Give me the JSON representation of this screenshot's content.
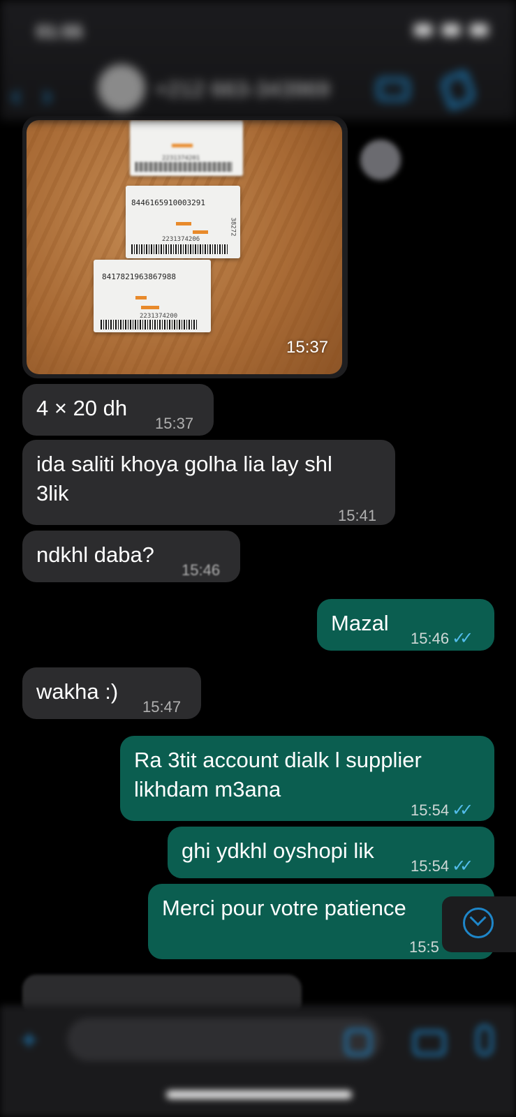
{
  "status_bar": {
    "time": "01:55"
  },
  "header": {
    "contact_name": "+212 663-343969"
  },
  "photo_message": {
    "time": "15:37",
    "cards": [
      {
        "code": "",
        "serial": "2231374201"
      },
      {
        "code": "8446165910003291",
        "serial": "2231374206",
        "side": "38272"
      },
      {
        "code": "8417821963867988",
        "serial": "2231374200"
      }
    ]
  },
  "messages": [
    {
      "dir": "in",
      "text": "4 × 20 dh",
      "time": "15:37"
    },
    {
      "dir": "in",
      "text": "ida saliti khoya golha lia lay shl",
      "text2": "3lik",
      "time": "15:41"
    },
    {
      "dir": "in",
      "text": "ndkhl daba?",
      "time": "15:46"
    },
    {
      "dir": "out",
      "text": "Mazal",
      "time": "15:46",
      "ticks": "✓✓"
    },
    {
      "dir": "in",
      "text": "wakha :)",
      "time": "15:47"
    },
    {
      "dir": "out",
      "text": "Ra 3tit account dialk l supplier",
      "text2": "likhdam m3ana",
      "time": "15:54",
      "ticks": "✓✓"
    },
    {
      "dir": "out",
      "text": "ghi ydkhl oyshopi lik",
      "time": "15:54",
      "ticks": "✓✓"
    },
    {
      "dir": "out",
      "text": "Merci pour votre patience",
      "time": "15:5"
    }
  ],
  "colors": {
    "incoming": "#2c2c2e",
    "outgoing": "#0b5e50",
    "accent": "#1e86c9",
    "read_ticks": "#53bdeb"
  }
}
